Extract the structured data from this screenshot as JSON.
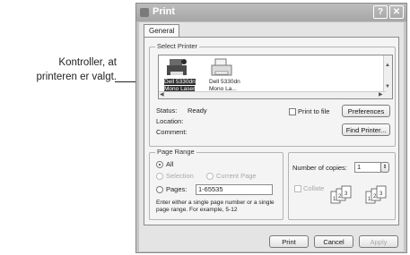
{
  "callout": {
    "line1": "Kontroller, at",
    "line2": "printeren er valgt."
  },
  "window": {
    "title": "Print",
    "help_label": "?",
    "close_label": "✕"
  },
  "tabs": [
    {
      "label": "General"
    }
  ],
  "select_printer": {
    "title": "Select Printer",
    "printers": [
      {
        "line1": "Dell 5330dn",
        "line2": "Mono Laser",
        "selected": true,
        "icon": "printer-icon"
      },
      {
        "line1": "Dell 5330dn",
        "line2": "Mono La...",
        "selected": false,
        "icon": "printer-icon"
      }
    ]
  },
  "status": {
    "status_label": "Status:",
    "status_value": "Ready",
    "location_label": "Location:",
    "comment_label": "Comment:",
    "print_to_file": "Print to file",
    "preferences": "Preferences",
    "find_printer": "Find Printer..."
  },
  "page_range": {
    "title": "Page Range",
    "all": "All",
    "selection": "Selection",
    "current_page": "Current Page",
    "pages": "Pages:",
    "pages_value": "1-65535",
    "hint_line1": "Enter either a single page number or a single",
    "hint_line2": "page range.  For example, 5-12"
  },
  "copies": {
    "label": "Number of copies:",
    "value": "1",
    "collate": "Collate"
  },
  "buttons": {
    "print": "Print",
    "cancel": "Cancel",
    "apply": "Apply"
  }
}
